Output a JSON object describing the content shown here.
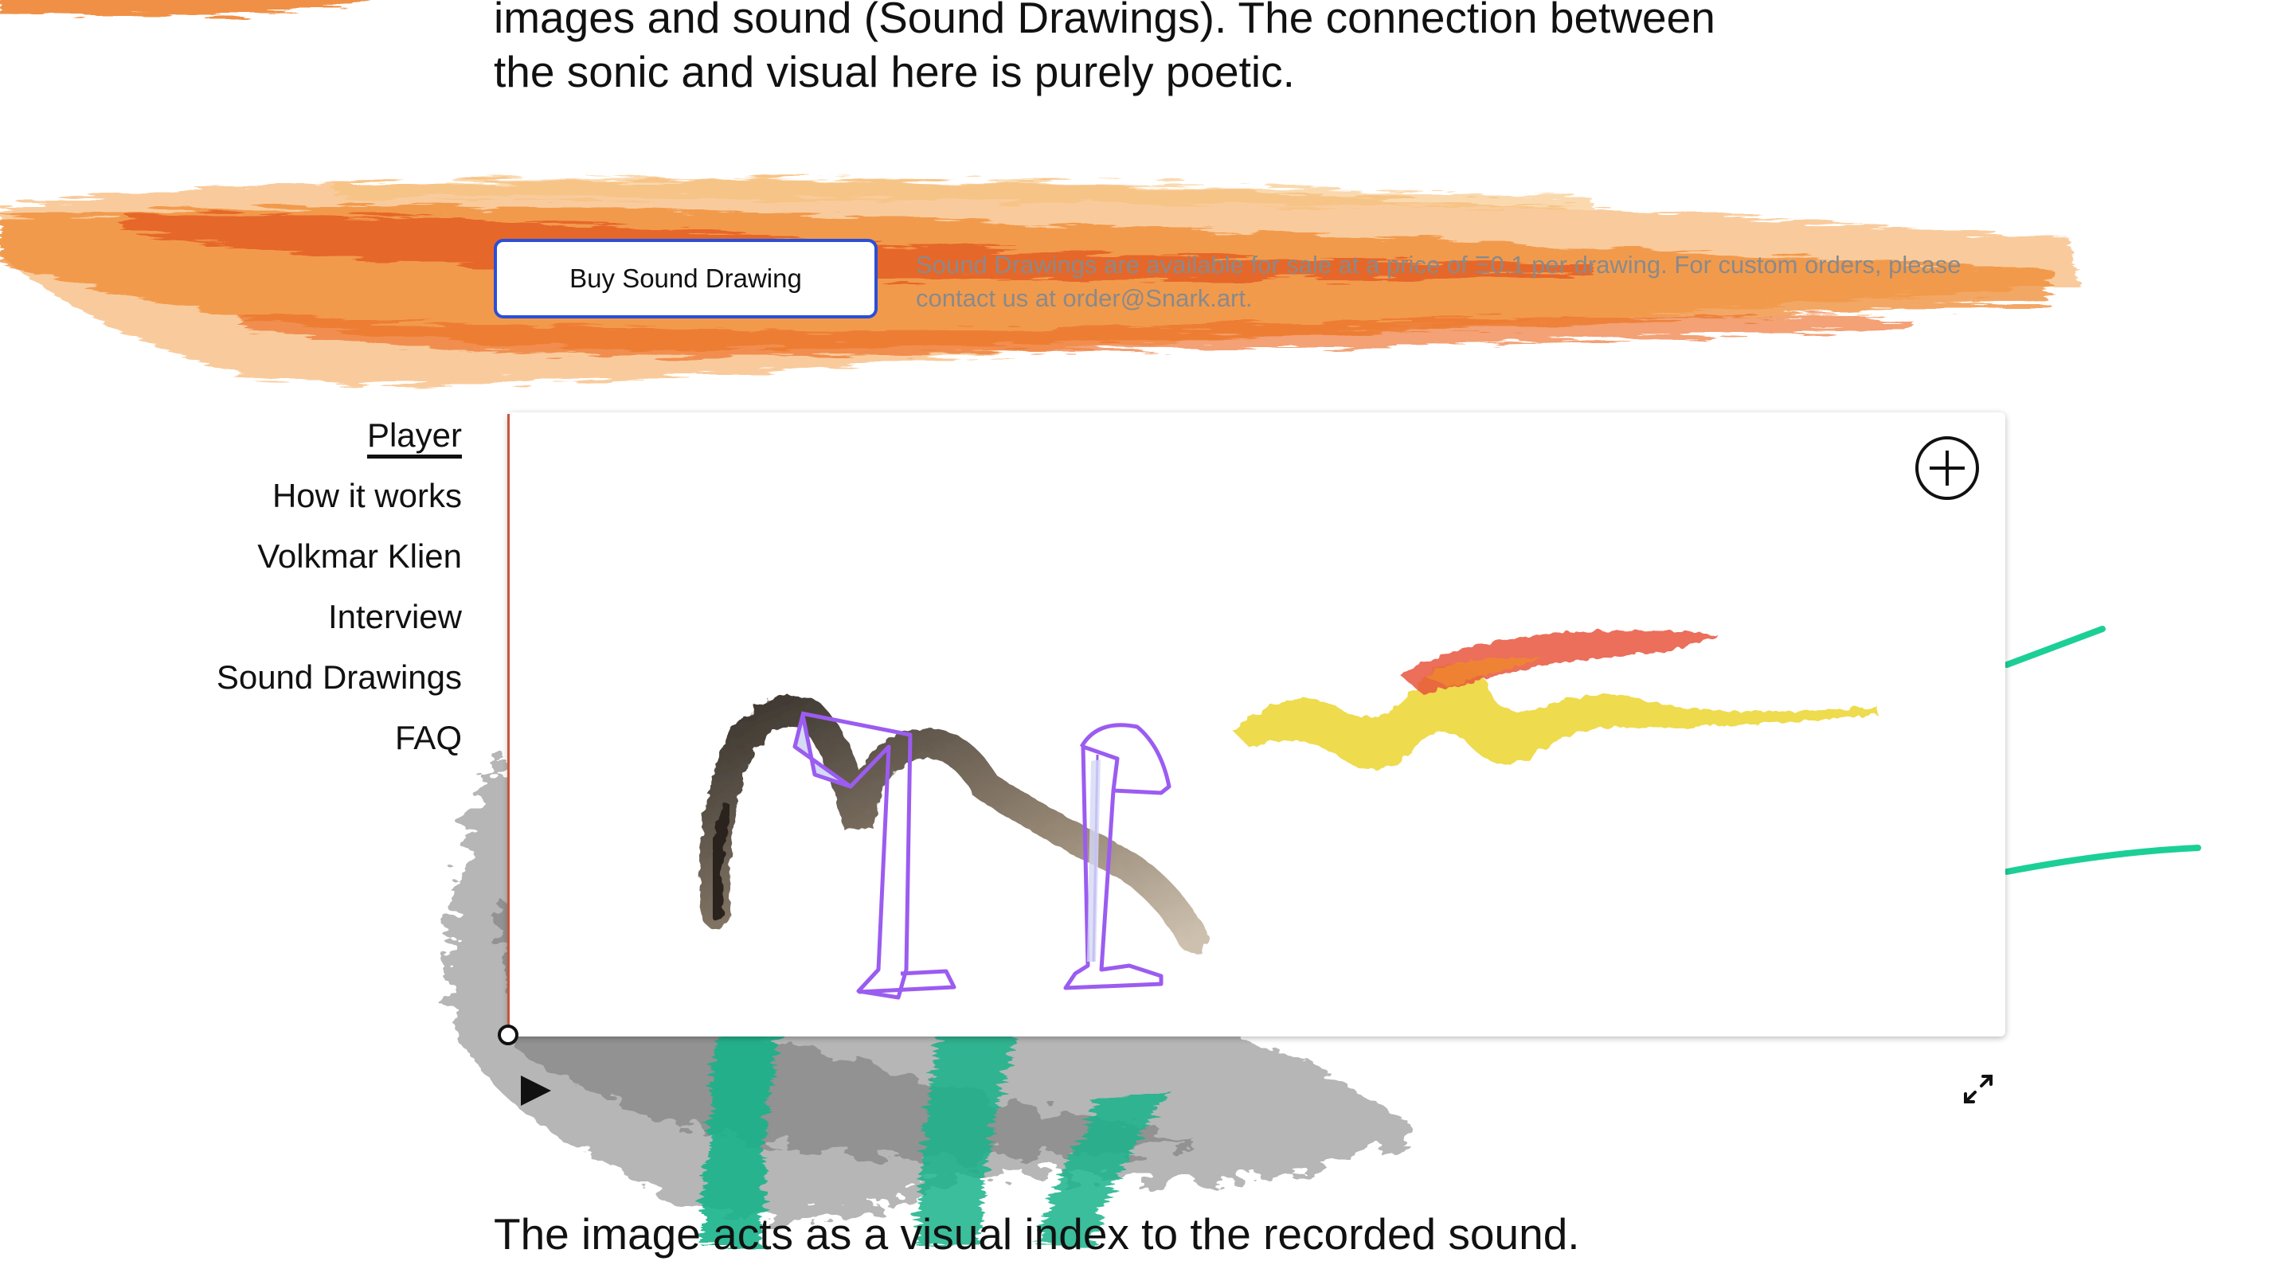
{
  "intro": {
    "lines": [
      "images and sound (Sound Drawings). The connection between",
      "the sonic and visual here is purely poetic."
    ]
  },
  "buy": {
    "button_label": "Buy Sound Drawing",
    "note_lines": [
      "Sound Drawings are available for sale at a price of Ξ0.1 per drawing. For custom orders, please",
      "contact us at order@Snark.art."
    ]
  },
  "nav": {
    "items": [
      {
        "label": "Player",
        "active": true
      },
      {
        "label": "How it works",
        "active": false
      },
      {
        "label": "Volkmar Klien",
        "active": false
      },
      {
        "label": "Interview",
        "active": false
      },
      {
        "label": "Sound Drawings",
        "active": false
      },
      {
        "label": "FAQ",
        "active": false
      }
    ]
  },
  "player": {
    "add_icon": "plus-circle-icon",
    "play_icon": "play-icon",
    "fullscreen_icon": "expand-icon",
    "colors": {
      "progress": "#c8563a",
      "outline": "#9b5cf0",
      "yellow": "#ecd73a",
      "red": "#e8553c",
      "ink": "#6b5a45"
    }
  },
  "outro": {
    "text": "The image acts as a visual index to the recorded sound."
  },
  "palette": {
    "orange": "#f08a2e",
    "orange_dark": "#e0531e",
    "teal": "#14b389",
    "gray": "#6d6d6d",
    "button_border": "#2b4fd6"
  }
}
